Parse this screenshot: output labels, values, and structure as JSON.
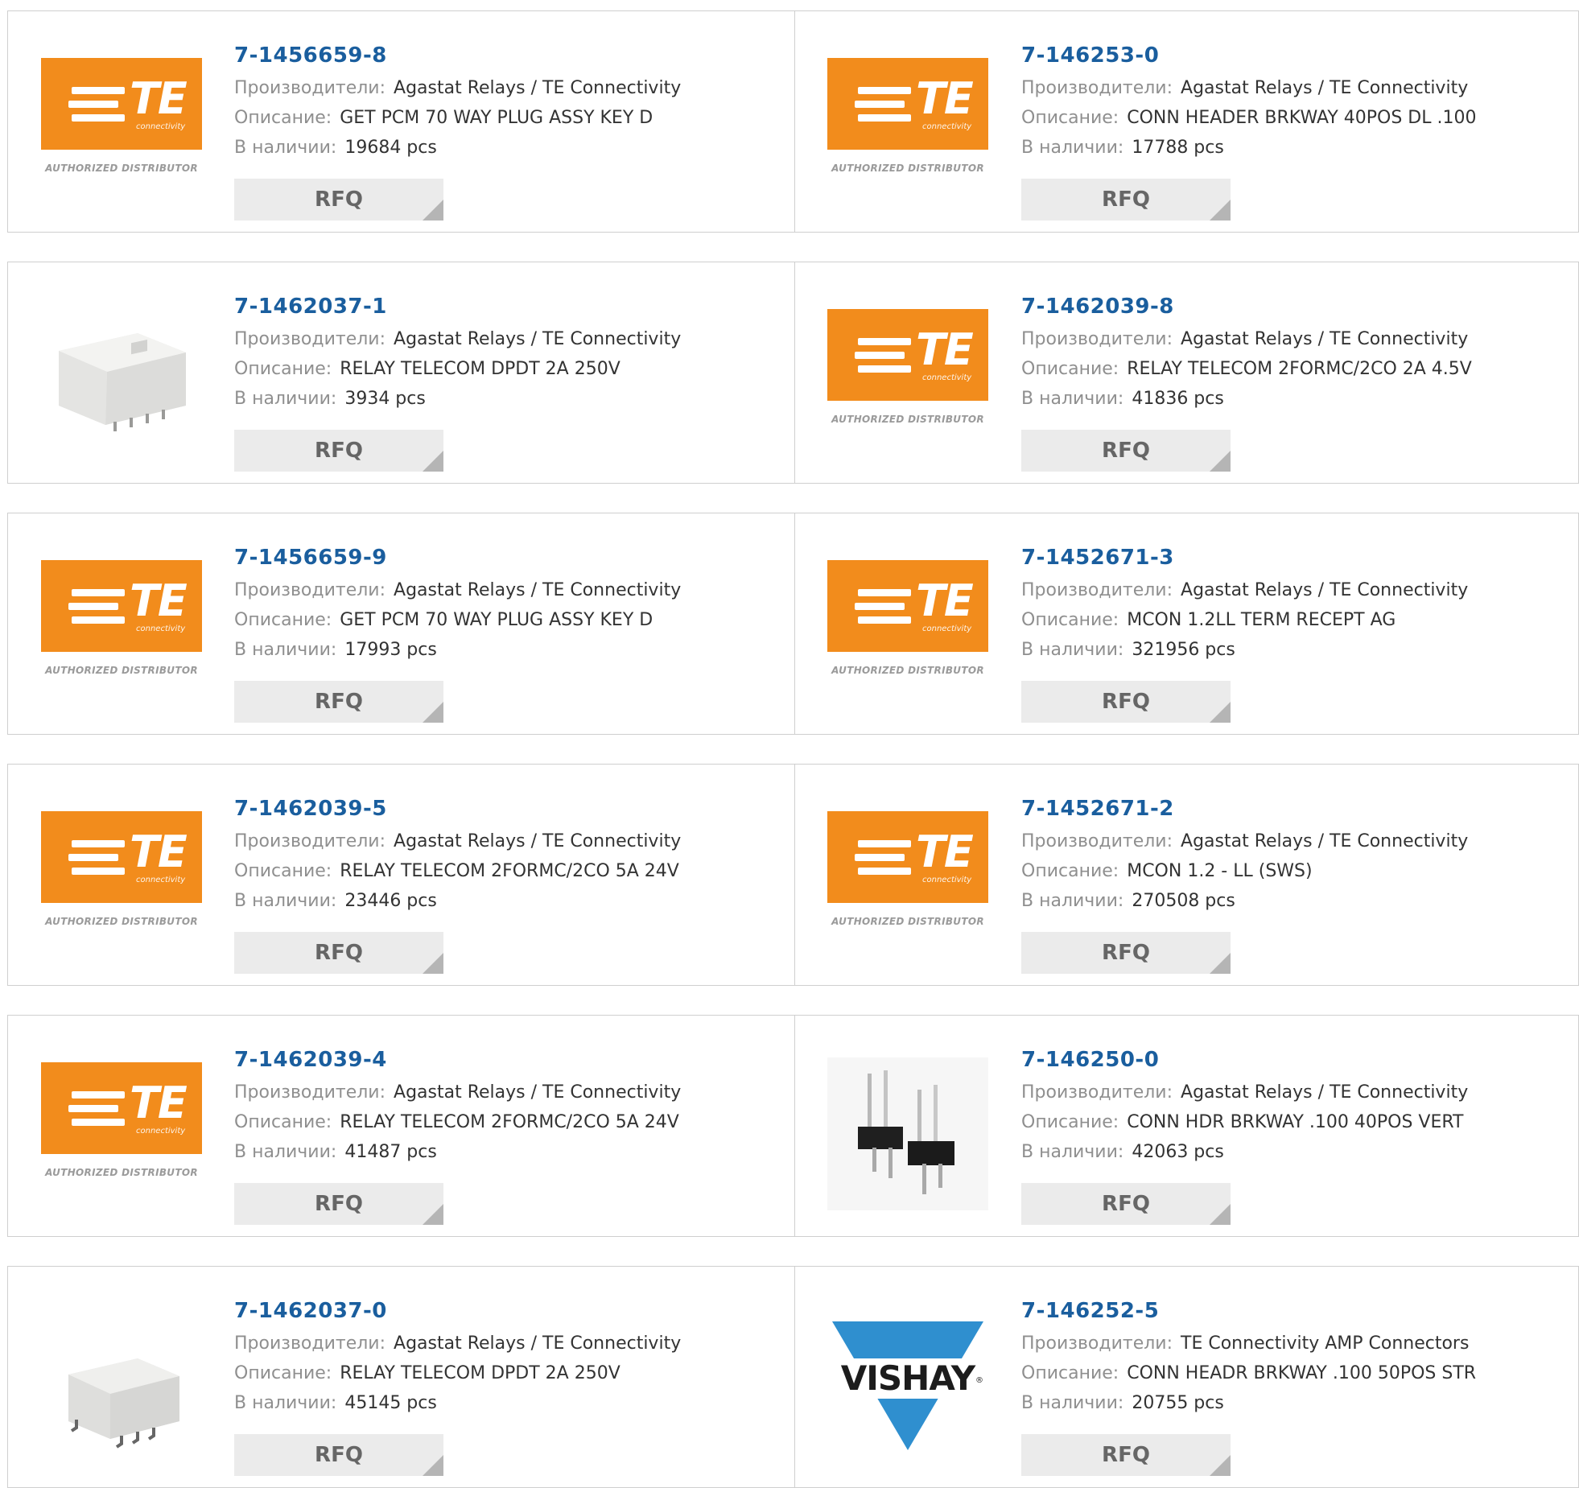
{
  "labels": {
    "manufacturer": "Производители:",
    "description": "Описание:",
    "stock": "В наличии:",
    "rfq": "RFQ"
  },
  "logo": {
    "te_letters": "TE",
    "te_sub": "connectivity",
    "te_auth": "AUTHORIZED DISTRIBUTOR",
    "vishay_word": "VISHAY",
    "vishay_reg": "®",
    "te_color": "#f28c1c",
    "vishay_color": "#2f8fcf"
  },
  "colors": {
    "part_number": "#1a5e9e",
    "label": "#8f8f8f",
    "rfq_bg": "#ebebeb"
  },
  "products": [
    {
      "part": "7-1456659-8",
      "manufacturer": "Agastat Relays / TE Connectivity",
      "description": "GET PCM 70 WAY PLUG ASSY KEY D",
      "stock": "19684 pcs",
      "image": "te-logo"
    },
    {
      "part": "7-146253-0",
      "manufacturer": "Agastat Relays / TE Connectivity",
      "description": "CONN HEADER BRKWAY 40POS DL .100",
      "stock": "17788 pcs",
      "image": "te-logo"
    },
    {
      "part": "7-1462037-1",
      "manufacturer": "Agastat Relays / TE Connectivity",
      "description": "RELAY TELECOM DPDT 2A 250V",
      "stock": "3934 pcs",
      "image": "relay-photo"
    },
    {
      "part": "7-1462039-8",
      "manufacturer": "Agastat Relays / TE Connectivity",
      "description": "RELAY TELECOM 2FORMC/2CO 2A 4.5V",
      "stock": "41836 pcs",
      "image": "te-logo"
    },
    {
      "part": "7-1456659-9",
      "manufacturer": "Agastat Relays / TE Connectivity",
      "description": "GET PCM 70 WAY PLUG ASSY KEY D",
      "stock": "17993 pcs",
      "image": "te-logo"
    },
    {
      "part": "7-1452671-3",
      "manufacturer": "Agastat Relays / TE Connectivity",
      "description": "MCON 1.2LL TERM RECEPT AG",
      "stock": "321956 pcs",
      "image": "te-logo"
    },
    {
      "part": "7-1462039-5",
      "manufacturer": "Agastat Relays / TE Connectivity",
      "description": "RELAY TELECOM 2FORMC/2CO 5A 24V",
      "stock": "23446 pcs",
      "image": "te-logo"
    },
    {
      "part": "7-1452671-2",
      "manufacturer": "Agastat Relays / TE Connectivity",
      "description": "MCON 1.2 - LL (SWS)",
      "stock": "270508 pcs",
      "image": "te-logo"
    },
    {
      "part": "7-1462039-4",
      "manufacturer": "Agastat Relays / TE Connectivity",
      "description": "RELAY TELECOM 2FORMC/2CO 5A 24V",
      "stock": "41487 pcs",
      "image": "te-logo"
    },
    {
      "part": "7-146250-0",
      "manufacturer": "Agastat Relays / TE Connectivity",
      "description": "CONN HDR BRKWAY .100 40POS VERT",
      "stock": "42063 pcs",
      "image": "header-pins-photo"
    },
    {
      "part": "7-1462037-0",
      "manufacturer": "Agastat Relays / TE Connectivity",
      "description": "RELAY TELECOM DPDT 2A 250V",
      "stock": "45145 pcs",
      "image": "relay-smd-photo"
    },
    {
      "part": "7-146252-5",
      "manufacturer": "TE Connectivity AMP Connectors",
      "description": "CONN HEADR BRKWAY .100 50POS STR",
      "stock": "20755 pcs",
      "image": "vishay-logo"
    }
  ]
}
